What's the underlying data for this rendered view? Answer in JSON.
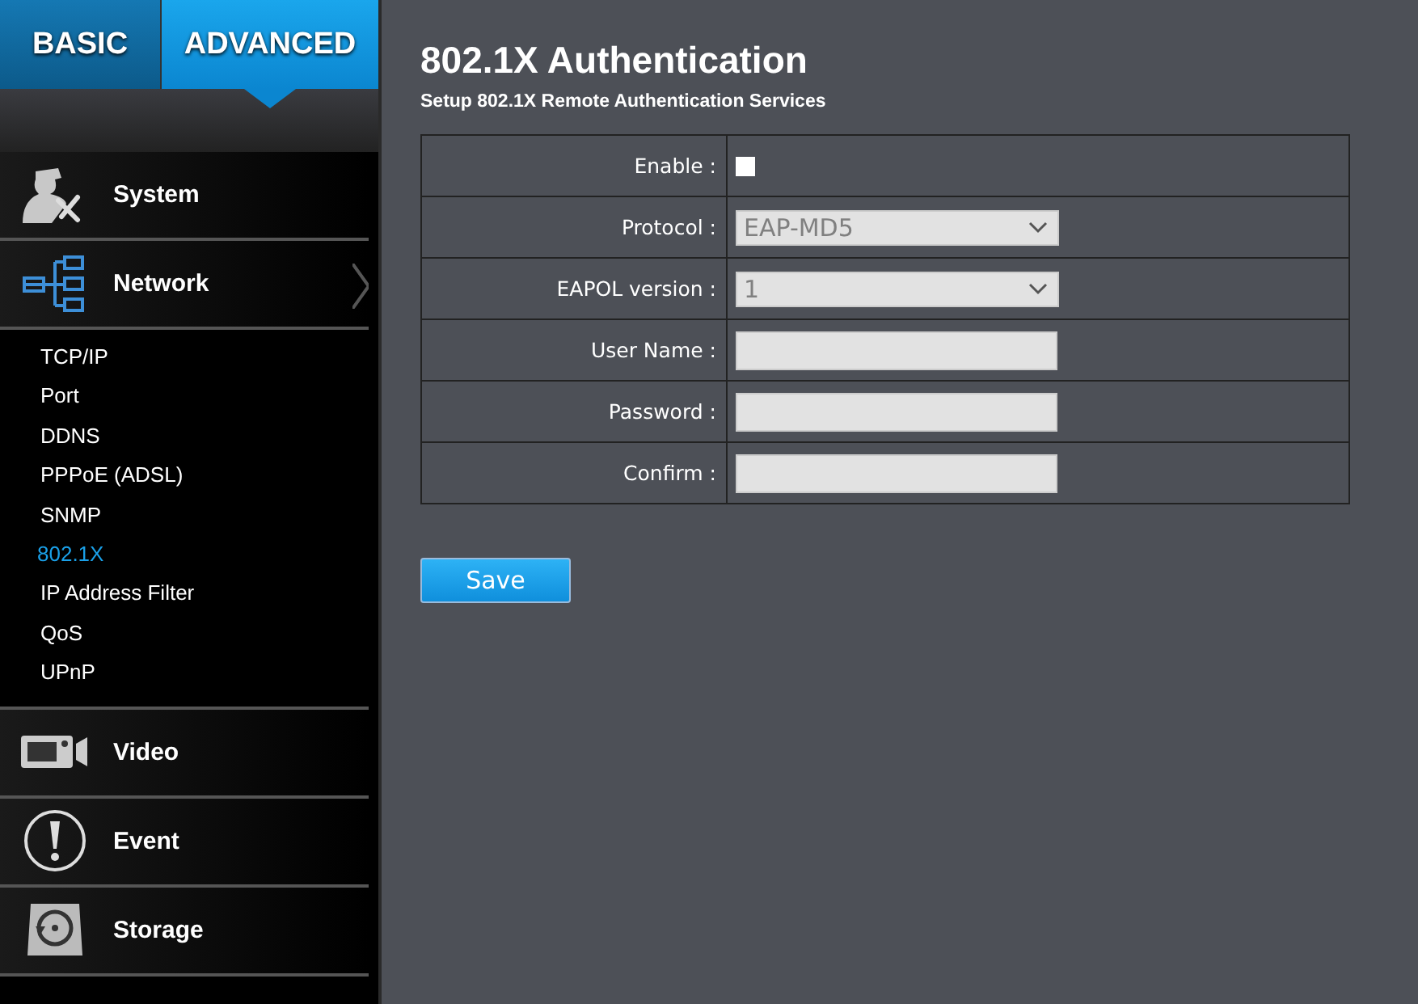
{
  "mode_tabs": [
    {
      "label": "BASIC",
      "selected": false
    },
    {
      "label": "ADVANCED",
      "selected": true
    }
  ],
  "sidebar": {
    "sections": [
      {
        "label": "System",
        "expanded": false
      },
      {
        "label": "Network",
        "expanded": true,
        "children": [
          {
            "label": "TCP/IP",
            "selected": false
          },
          {
            "label": "Port",
            "selected": false
          },
          {
            "label": "DDNS",
            "selected": false
          },
          {
            "label": "PPPoE (ADSL)",
            "selected": false
          },
          {
            "label": "SNMP",
            "selected": false
          },
          {
            "label": "802.1X",
            "selected": true
          },
          {
            "label": "IP Address Filter",
            "selected": false
          },
          {
            "label": "QoS",
            "selected": false
          },
          {
            "label": "UPnP",
            "selected": false
          }
        ]
      },
      {
        "label": "Video",
        "expanded": false
      },
      {
        "label": "Event",
        "expanded": false
      },
      {
        "label": "Storage",
        "expanded": false
      }
    ]
  },
  "page": {
    "title": "802.1X Authentication",
    "subtitle": "Setup 802.1X Remote Authentication Services"
  },
  "form": [
    {
      "kind": "checkbox",
      "label": "Enable :",
      "checked": false
    },
    {
      "kind": "select",
      "label": "Protocol :",
      "value": "EAP-MD5",
      "disabled": true
    },
    {
      "kind": "select",
      "label": "EAPOL version :",
      "value": "1",
      "disabled": true
    },
    {
      "kind": "text",
      "label": "User Name :"
    },
    {
      "kind": "password",
      "label": "Password :"
    },
    {
      "kind": "password",
      "label": "Confirm :"
    }
  ],
  "save_button": "Save"
}
